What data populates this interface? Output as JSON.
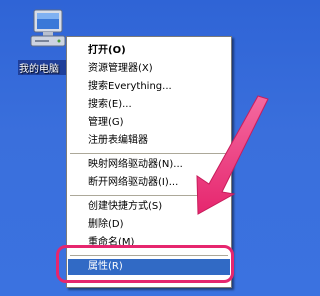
{
  "desktop": {
    "icon_name": "my-computer-icon",
    "icon_label": "我的电脑"
  },
  "context_menu": {
    "items": [
      {
        "label": "打开(O)",
        "bold": true
      },
      {
        "label": "资源管理器(X)"
      },
      {
        "label": "搜索Everything..."
      },
      {
        "label": "搜索(E)..."
      },
      {
        "label": "管理(G)"
      },
      {
        "label": "注册表编辑器"
      },
      {
        "label": "映射网络驱动器(N)..."
      },
      {
        "label": "断开网络驱动器(I)..."
      },
      {
        "label": "创建快捷方式(S)"
      },
      {
        "label": "删除(D)"
      },
      {
        "label": "重命名(M)"
      },
      {
        "label": "属性(R)",
        "selected": true
      }
    ]
  },
  "annotation": {
    "arrow_color": "#e6266e",
    "highlight_color": "#e6266e"
  }
}
